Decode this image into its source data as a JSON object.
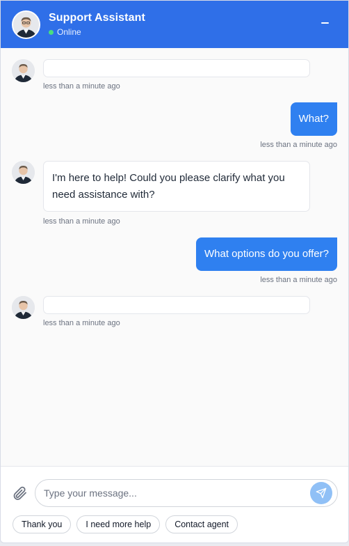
{
  "header": {
    "title": "Support Assistant",
    "status": "Online",
    "avatar_icon": "assistant-photo-avatar",
    "minimize_icon": "minimize-icon"
  },
  "messages": [
    {
      "from": "bot",
      "text": "",
      "time": "less than a minute ago"
    },
    {
      "from": "user",
      "text": "What?",
      "time": "less than a minute ago"
    },
    {
      "from": "bot",
      "text": "I'm here to help! Could you please clarify what you need assistance with?",
      "time": "less than a minute ago"
    },
    {
      "from": "user",
      "text": "What options do you offer?",
      "time": "less than a minute ago"
    },
    {
      "from": "bot",
      "text": "",
      "time": "less than a minute ago"
    }
  ],
  "composer": {
    "placeholder": "Type your message...",
    "value": "",
    "attach_icon": "paperclip-icon",
    "send_icon": "send-icon"
  },
  "quick_replies": [
    "Thank you",
    "I need more help",
    "Contact agent"
  ],
  "colors": {
    "header_bg": "#2f6fe8",
    "user_bubble": "#2f80f0",
    "online_dot": "#4ade80",
    "send_button": "#90c0f6"
  }
}
